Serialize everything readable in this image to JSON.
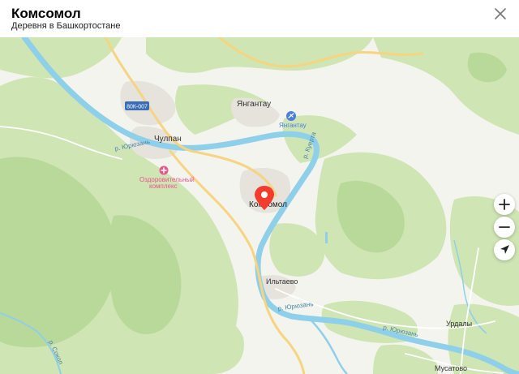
{
  "header": {
    "title": "Комсомол",
    "subtitle": "Деревня в Башкортостане",
    "close_icon": "close-icon"
  },
  "map": {
    "colors": {
      "land": "#f4f4ef",
      "forest": "#cfe5b4",
      "forest_dark": "#b9d99a",
      "water": "#8ecfea",
      "road_major": "#f6d480",
      "road_minor": "#ffffff",
      "place_pin": "#f43c2c",
      "poi_pink": "#e8568a",
      "airport_blue": "#4a7fe0"
    },
    "labels": {
      "komsomol": "Комсомол",
      "chulpan": "Чулпан",
      "yangantau": "Янгантау",
      "yangantau_airport": "Янгантау",
      "iltaevo": "Ильтаево",
      "urdaly": "Урдалы",
      "musatovo": "Мусатово",
      "health_complex_1": "Оздоровительный",
      "health_complex_2": "комплекс",
      "road_badge": "80К-007",
      "river_yuryuzan_1": "р. Юрюзань",
      "river_yuryuzan_2": "р. Юрюзань",
      "river_yuryuzan_3": "р. Юрюзань",
      "river_kuertau": "р. Куерта",
      "river_sokolok": "р. Сокол"
    },
    "controls": {
      "zoom_in": "plus-icon",
      "zoom_out": "minus-icon",
      "locate": "location-arrow-icon"
    }
  }
}
